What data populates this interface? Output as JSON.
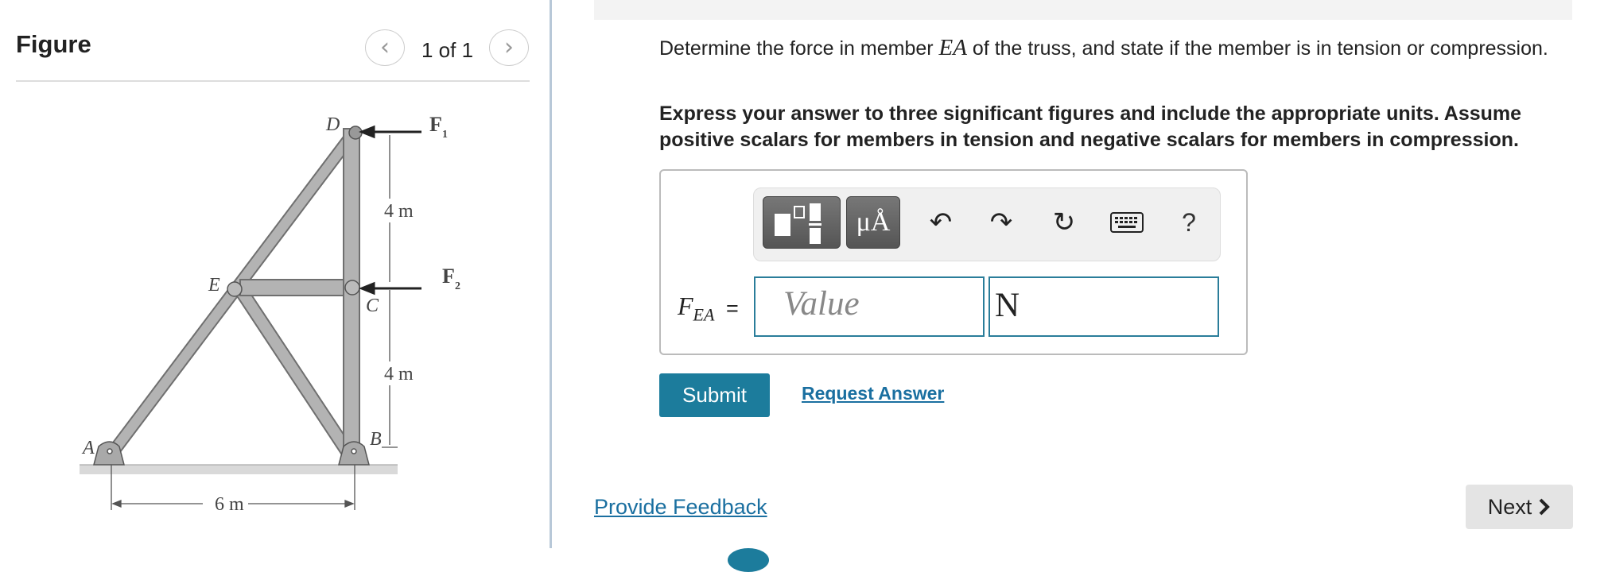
{
  "figure_pane": {
    "title": "Figure",
    "pager": "1 of 1",
    "prev_icon": "chevron-left-icon",
    "next_icon": "chevron-right-icon",
    "diagram": {
      "labels": {
        "A": "A",
        "B": "B",
        "C": "C",
        "D": "D",
        "E": "E"
      },
      "dims": {
        "upper": "4 m",
        "lower": "4 m",
        "base": "6 m"
      },
      "forces": {
        "f1": "F",
        "f1_sub": "1",
        "f2": "F",
        "f2_sub": "2"
      }
    }
  },
  "question": {
    "text_before": "Determine the force in member ",
    "member": "EA",
    "text_after": " of the truss, and state if the member is in tension or compression.",
    "instructions": "Express your answer to three significant figures and include the appropriate units. Assume positive scalars for members in tension and negative scalars for members in compression."
  },
  "answer": {
    "toolbar": {
      "symbols_label": "μÅ",
      "undo_icon": "↶",
      "redo_icon": "↷",
      "reset_icon": "↻",
      "keyboard_icon": "keyboard-icon",
      "help_label": "?"
    },
    "variable": "F",
    "variable_sub": "EA",
    "equals": "=",
    "value_placeholder": "Value",
    "units_value": "N"
  },
  "actions": {
    "submit": "Submit",
    "request_answer": "Request Answer",
    "feedback": "Provide Feedback",
    "next": "Next"
  },
  "colors": {
    "accent": "#1c7c9c",
    "link": "#1a6fa0",
    "member_fill": "#b3b3b3",
    "member_stroke": "#6f6f6f"
  }
}
